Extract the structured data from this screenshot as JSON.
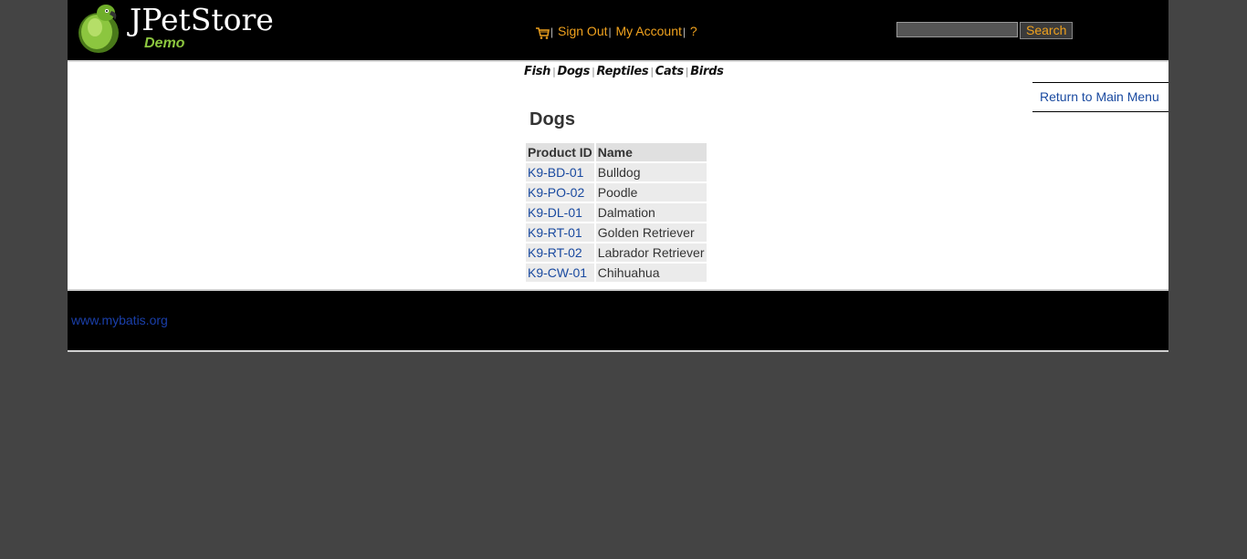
{
  "header": {
    "logo_title": "JPetStore",
    "logo_subtitle": "Demo",
    "menu": {
      "sign_out": "Sign Out",
      "my_account": "My Account",
      "help": "?",
      "separator": "|"
    },
    "search": {
      "value": "",
      "button_label": "Search"
    }
  },
  "quick_links": {
    "fish": "Fish",
    "dogs": "Dogs",
    "reptiles": "Reptiles",
    "cats": "Cats",
    "birds": "Birds",
    "separator": "|"
  },
  "back_link": "Return to Main Menu",
  "catalog": {
    "title": "Dogs",
    "columns": [
      "Product ID",
      "Name"
    ],
    "rows": [
      {
        "id": "K9-BD-01",
        "name": "Bulldog"
      },
      {
        "id": "K9-PO-02",
        "name": "Poodle"
      },
      {
        "id": "K9-DL-01",
        "name": "Dalmation"
      },
      {
        "id": "K9-RT-01",
        "name": "Golden Retriever"
      },
      {
        "id": "K9-RT-02",
        "name": "Labrador Retriever"
      },
      {
        "id": "K9-CW-01",
        "name": "Chihuahua"
      }
    ]
  },
  "footer": {
    "link": "www.mybatis.org"
  },
  "colors": {
    "accent": "#f0a21e",
    "link": "#1a4aa0",
    "header_bg": "#000000",
    "page_bg": "#444444"
  }
}
